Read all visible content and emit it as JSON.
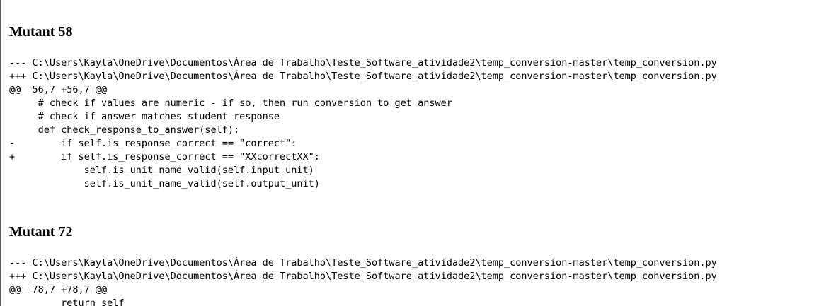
{
  "mutants": [
    {
      "title": "Mutant 58",
      "lines": [
        "--- C:\\Users\\Kayla\\OneDrive\\Documentos\\Área de Trabalho\\Teste_Software_atividade2\\temp_conversion-master\\temp_conversion.py",
        "+++ C:\\Users\\Kayla\\OneDrive\\Documentos\\Área de Trabalho\\Teste_Software_atividade2\\temp_conversion-master\\temp_conversion.py",
        "@@ -56,7 +56,7 @@",
        "     # check if values are numeric - if so, then run conversion to get answer",
        "     # check if answer matches student response",
        "     def check_response_to_answer(self):",
        "-        if self.is_response_correct == \"correct\":",
        "+        if self.is_response_correct == \"XXcorrectXX\":",
        "             self.is_unit_name_valid(self.input_unit)",
        "             self.is_unit_name_valid(self.output_unit)"
      ]
    },
    {
      "title": "Mutant 72",
      "lines": [
        "--- C:\\Users\\Kayla\\OneDrive\\Documentos\\Área de Trabalho\\Teste_Software_atividade2\\temp_conversion-master\\temp_conversion.py",
        "+++ C:\\Users\\Kayla\\OneDrive\\Documentos\\Área de Trabalho\\Teste_Software_atividade2\\temp_conversion-master\\temp_conversion.py",
        "@@ -78,7 +78,7 @@",
        "         return self"
      ]
    }
  ]
}
